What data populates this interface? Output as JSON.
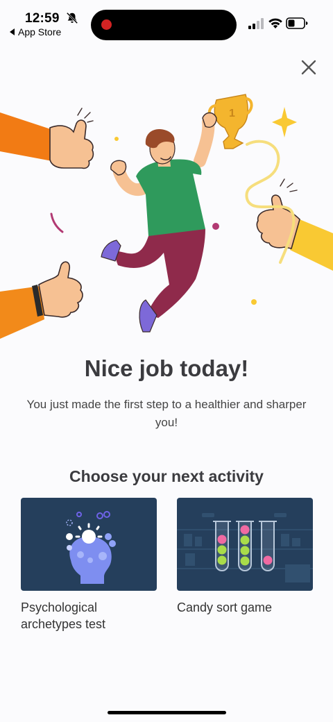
{
  "status": {
    "time": "12:59",
    "back_label": "App Store"
  },
  "hero": {
    "trophy_number": "1"
  },
  "content": {
    "headline": "Nice job today!",
    "subtitle": "You just made the first step to a healthier and sharper you!",
    "section_title": "Choose your next activity"
  },
  "activities": [
    {
      "label": "Psychological archetypes test",
      "icon": "head-burst-icon"
    },
    {
      "label": "Candy sort game",
      "icon": "ball-tubes-icon"
    }
  ],
  "colors": {
    "card_bg": "#253f5c",
    "accent_purple": "#6f63e8",
    "shirt_green": "#2f9a5c",
    "pants_maroon": "#8f2a4b",
    "sleeve_orange": "#f28a1a",
    "sleeve_yellow": "#f9c933"
  }
}
